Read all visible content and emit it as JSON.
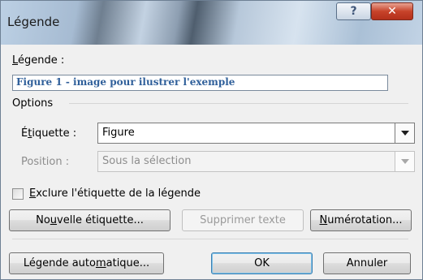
{
  "window": {
    "title": "Légende",
    "help_glyph": "?",
    "close_glyph": "✕"
  },
  "caption": {
    "label_pre": "",
    "label_key": "L",
    "label_post": "égende :",
    "value": "Figure 1 - image pour ilustrer l'exemple"
  },
  "options": {
    "group_label": "Options",
    "etiquette": {
      "label_pre": "É",
      "label_key": "t",
      "label_post": "iquette :",
      "value": "Figure"
    },
    "position": {
      "label": "Position :",
      "value": "Sous la sélection"
    },
    "exclude": {
      "label_pre": "",
      "label_key": "E",
      "label_post": "xclure l'étiquette de la légende",
      "checked": false
    }
  },
  "buttons": {
    "new_label": {
      "pre": "No",
      "key": "u",
      "post": "velle étiquette..."
    },
    "delete_text": "Supprimer texte",
    "numbering": {
      "pre": "",
      "key": "N",
      "post": "umérotation..."
    },
    "auto_caption": {
      "pre": "Légende auto",
      "key": "m",
      "post": "atique..."
    },
    "ok": "OK",
    "cancel": "Annuler"
  }
}
